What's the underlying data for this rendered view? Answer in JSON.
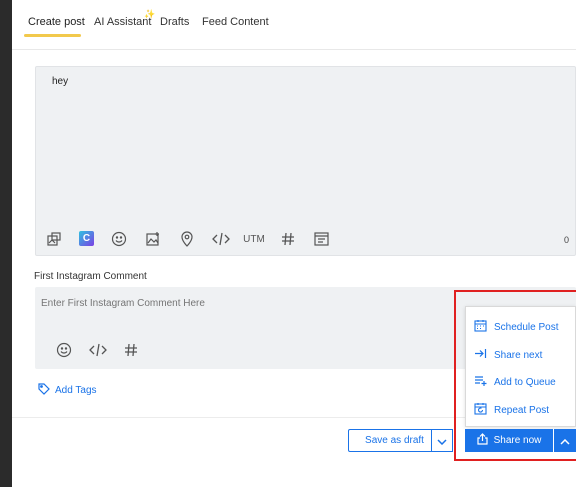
{
  "tabs": [
    {
      "label": "Create post"
    },
    {
      "label": "AI Assistant"
    },
    {
      "label": "Drafts"
    },
    {
      "label": "Feed Content"
    }
  ],
  "sparkle_icon": "sparkle-icon",
  "editor": {
    "text": "hey",
    "counter": "0",
    "toolbar": {
      "utm_label": "UTM",
      "icons": [
        "media-icon",
        "canva-icon",
        "emoji-icon",
        "image-gallery-icon",
        "location-icon",
        "code-icon",
        "hashtag-icon",
        "template-icon"
      ]
    }
  },
  "first_comment": {
    "label": "First Instagram Comment",
    "placeholder": "Enter First Instagram Comment Here",
    "icons": [
      "emoji-icon",
      "code-icon",
      "hashtag-icon"
    ]
  },
  "tags": {
    "label": "Add Tags"
  },
  "actions": {
    "save_draft": "Save as draft",
    "share_now": "Share now"
  },
  "share_menu": {
    "items": [
      {
        "label": "Schedule Post",
        "icon": "calendar-icon"
      },
      {
        "label": "Share next",
        "icon": "skip-to-icon"
      },
      {
        "label": "Add to Queue",
        "icon": "queue-add-icon"
      },
      {
        "label": "Repeat Post",
        "icon": "repeat-calendar-icon"
      }
    ]
  },
  "colors": {
    "accent": "#1a73e8",
    "tab_underline": "#f2c94c",
    "highlight": "#e02020"
  }
}
